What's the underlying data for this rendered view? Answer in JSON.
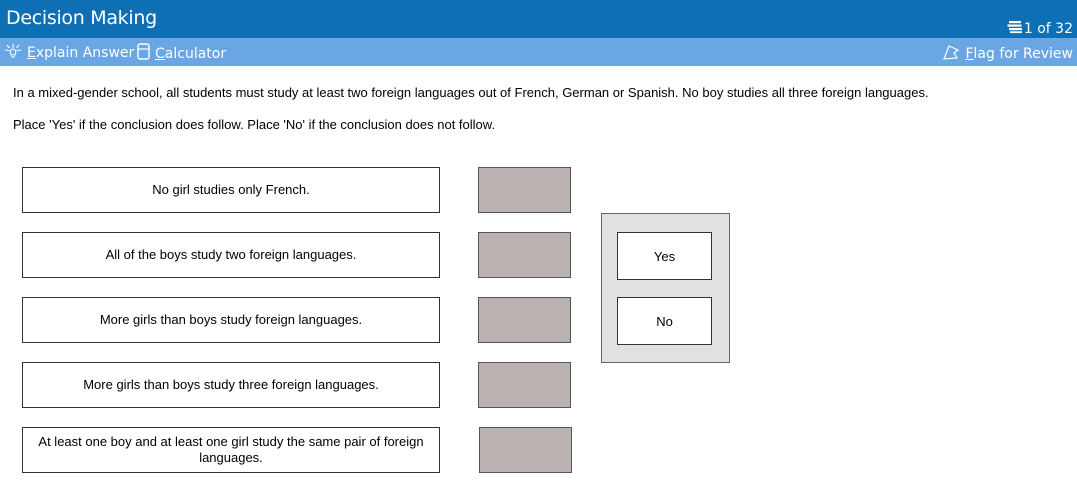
{
  "header": {
    "title": "Decision Making",
    "counter": "1 of 32"
  },
  "toolbar": {
    "explain_label": "Explain Answer",
    "calculator_label": "Calculator",
    "flag_label": "Flag for Review"
  },
  "question": {
    "stem": "In a mixed-gender school, all students must study at least two foreign languages out of French, German or Spanish. No boy studies all three foreign languages.",
    "instruction": "Place 'Yes' if the conclusion does follow. Place 'No' if the conclusion does not follow.",
    "statements": [
      "No girl studies only French.",
      "All of the boys study two foreign languages.",
      "More girls than boys study foreign languages.",
      "More girls than boys study three foreign languages.",
      "At least one boy and at least one girl study the same pair of foreign languages."
    ],
    "options": [
      "Yes",
      "No"
    ]
  },
  "colors": {
    "title_bar": "#0e6fb5",
    "tool_bar": "#6aa6e3",
    "dropzone": "#bab3b1",
    "palette": "#e1e1e1"
  }
}
